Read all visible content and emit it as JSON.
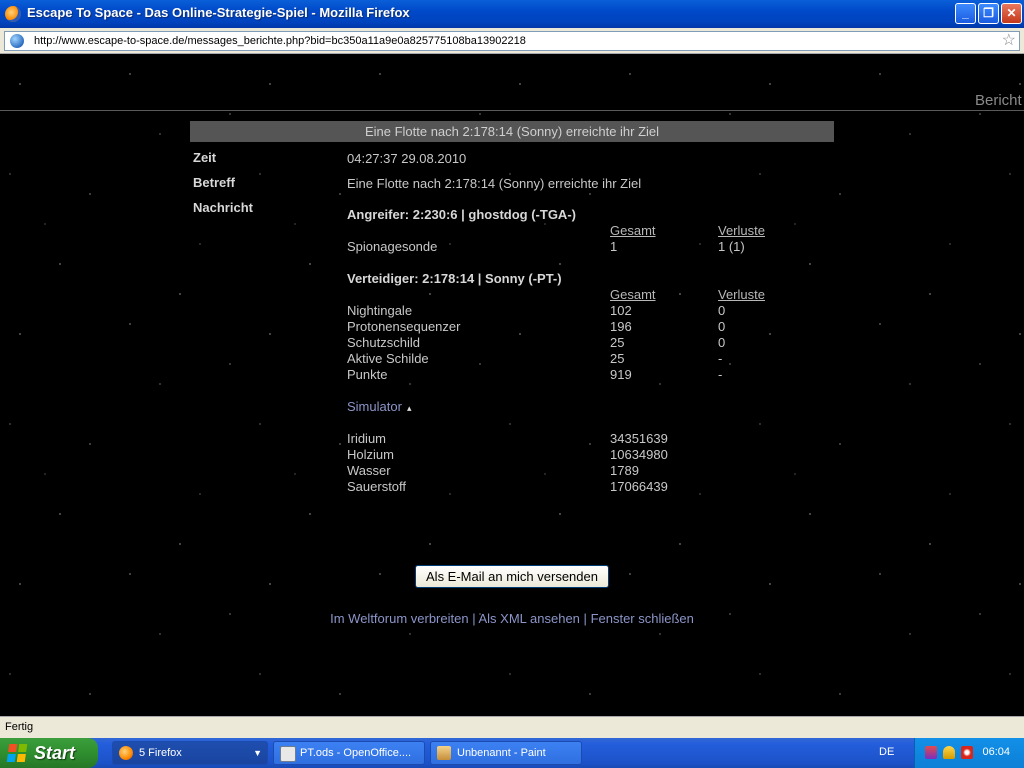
{
  "window": {
    "title": "Escape To Space - Das Online-Strategie-Spiel - Mozilla Firefox",
    "min": "_",
    "max": "❐",
    "close": "✕"
  },
  "urlbar": {
    "url": "http://www.escape-to-space.de/messages_berichte.php?bid=bc350a11a9e0a825775108ba13902218"
  },
  "page": {
    "section_heading": "Bericht",
    "header_bar": "Eine Flotte nach 2:178:14 (Sonny) erreichte ihr Ziel",
    "labels": {
      "time": "Zeit",
      "subject": "Betreff",
      "message": "Nachricht"
    },
    "time_value": "04:27:37 29.08.2010",
    "subject_value": "Eine Flotte nach 2:178:14 (Sonny) erreichte ihr Ziel",
    "attacker": {
      "title": "Angreifer: 2:230:6 | ghostdog (-TGA-)",
      "col_total": "Gesamt",
      "col_losses": "Verluste",
      "rows": [
        {
          "name": "Spionagesonde",
          "total": "1",
          "losses": "1 (1)"
        }
      ]
    },
    "defender": {
      "title": "Verteidiger: 2:178:14 | Sonny (-PT-)",
      "col_total": "Gesamt",
      "col_losses": "Verluste",
      "rows": [
        {
          "name": "Nightingale",
          "total": "102",
          "losses": "0"
        },
        {
          "name": "Protonensequenzer",
          "total": "196",
          "losses": "0"
        },
        {
          "name": "Schutzschild",
          "total": "25",
          "losses": "0"
        },
        {
          "name": "Aktive Schilde",
          "total": "25",
          "losses": "-"
        },
        {
          "name": "Punkte",
          "total": "919",
          "losses": "-"
        }
      ]
    },
    "simulator_link": "Simulator",
    "resources": [
      {
        "name": "Iridium",
        "value": "34351639"
      },
      {
        "name": "Holzium",
        "value": "10634980"
      },
      {
        "name": "Wasser",
        "value": "1789"
      },
      {
        "name": "Sauerstoff",
        "value": "17066439"
      }
    ],
    "mail_button": "Als E-Mail an mich versenden",
    "footer_links": {
      "forum": "Im Weltforum verbreiten",
      "xml": "Als XML ansehen",
      "close": "Fenster schließen",
      "separator": "|"
    }
  },
  "statusbar": {
    "status": "Fertig"
  },
  "taskbar": {
    "start_label": "Start",
    "tasks": [
      {
        "label": "5 Firefox",
        "icon": "firefox-icon"
      },
      {
        "label": "PT.ods - OpenOffice....",
        "icon": "openoffice-icon"
      },
      {
        "label": "Unbenannt - Paint",
        "icon": "paint-icon"
      }
    ],
    "language": "DE",
    "clock": "06:04"
  }
}
